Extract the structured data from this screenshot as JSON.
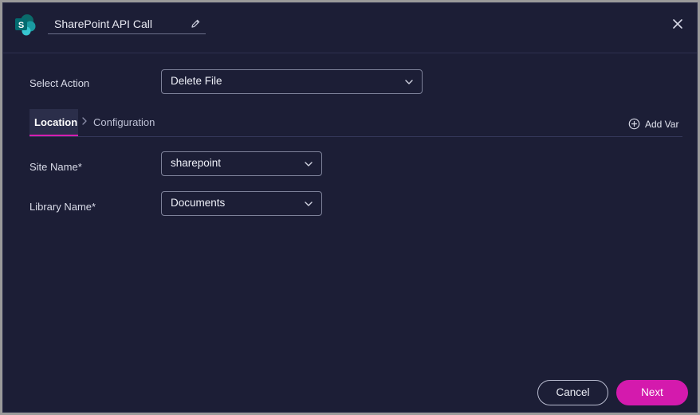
{
  "header": {
    "title": "SharePoint API Call",
    "logo_icon": "sharepoint-logo-icon",
    "edit_icon": "pencil-icon",
    "close_icon": "close-icon"
  },
  "action": {
    "label": "Select Action",
    "value": "Delete File"
  },
  "tabs": {
    "items": [
      {
        "label": "Location",
        "active": true
      },
      {
        "label": "Configuration",
        "active": false
      }
    ],
    "separator_icon": "chevron-right-icon",
    "add_var_label": "Add Var",
    "add_var_icon": "plus-circle-icon"
  },
  "form": {
    "site_name_label": "Site Name*",
    "site_name_value": "sharepoint",
    "library_name_label": "Library Name*",
    "library_name_value": "Documents"
  },
  "footer": {
    "cancel_label": "Cancel",
    "next_label": "Next"
  },
  "colors": {
    "background": "#1c1e36",
    "accent": "#d41aad",
    "active_tab_bg": "#2b2e4a",
    "border": "#7d8199"
  }
}
